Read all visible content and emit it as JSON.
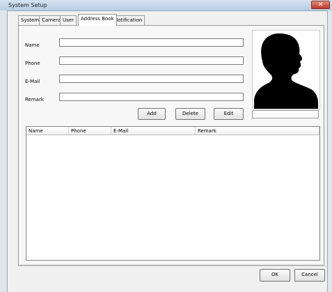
{
  "window": {
    "title": "System Setup",
    "close_symbol": "✕"
  },
  "tabs": [
    {
      "label": "System"
    },
    {
      "label": "Camera"
    },
    {
      "label": "User"
    },
    {
      "label": "Address Book"
    },
    {
      "label": "Notification"
    }
  ],
  "active_tab": "Address Book",
  "form": {
    "fields": [
      {
        "label": "Name",
        "value": ""
      },
      {
        "label": "Phone",
        "value": ""
      },
      {
        "label": "E-Mail",
        "value": ""
      },
      {
        "label": "Remark",
        "value": ""
      }
    ]
  },
  "photo": {
    "icon": "person-silhouette-icon",
    "caption": ""
  },
  "actions": {
    "add": "Add",
    "delete": "Delete",
    "edit": "Edit"
  },
  "list": {
    "columns": [
      "Name",
      "Phone",
      "E-Mail",
      "Remark"
    ],
    "rows": []
  },
  "footer": {
    "ok": "OK",
    "cancel": "Cancel"
  }
}
